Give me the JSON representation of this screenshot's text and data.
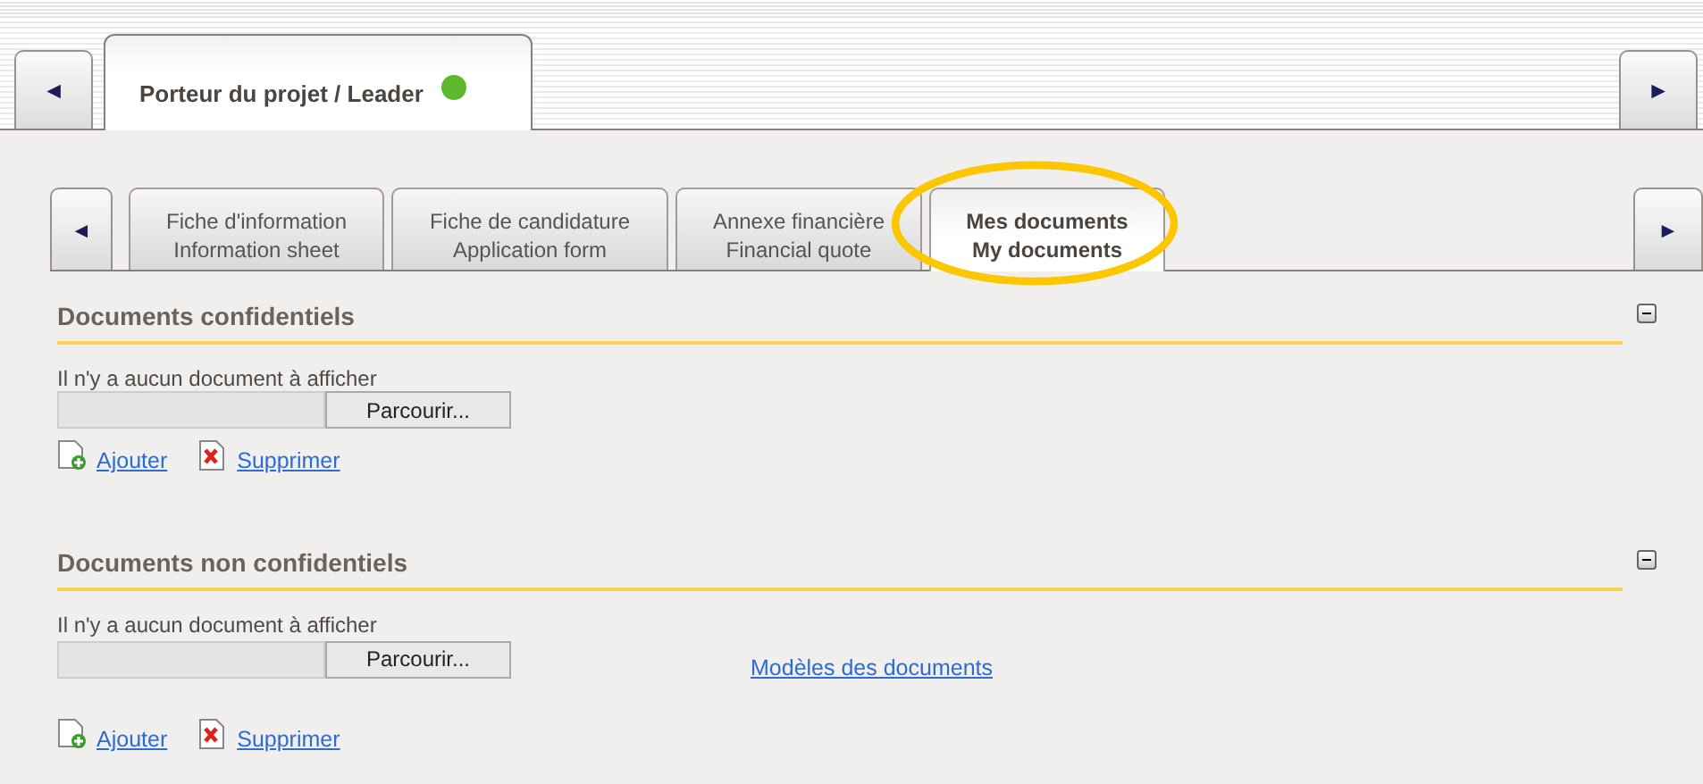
{
  "project_tabs": {
    "prev": "◄",
    "next": "►",
    "tabs": [
      {
        "label": "Porteur du projet / Leader",
        "selected": true,
        "color": "#5db82e"
      }
    ]
  },
  "sub_tabs": {
    "prev": "◄",
    "next": "►",
    "tabs": [
      {
        "lines": [
          "Fiche d'information",
          "Information sheet"
        ],
        "selected": false
      },
      {
        "lines": [
          "Fiche de candidature",
          "Application form"
        ],
        "selected": false
      },
      {
        "lines": [
          "Annexe financière",
          "Financial quote"
        ],
        "selected": false
      },
      {
        "lines": [
          "Mes documents",
          "My documents"
        ],
        "selected": true
      }
    ]
  },
  "sections": [
    {
      "title": "Documents confidentiels",
      "message": "Il n'y a aucun document à afficher",
      "browse_button": "Parcourir...",
      "actions": [
        {
          "kind": "add",
          "label": "Ajouter"
        },
        {
          "kind": "delete",
          "label": "Supprimer"
        }
      ]
    },
    {
      "title": "Documents non confidentiels",
      "message": "Il n'y a aucun document à afficher",
      "browse_button": "Parcourir...",
      "templates_link": "Modèles des documents",
      "actions": [
        {
          "kind": "add",
          "label": "Ajouter"
        },
        {
          "kind": "delete",
          "label": "Supprimer"
        }
      ]
    }
  ]
}
